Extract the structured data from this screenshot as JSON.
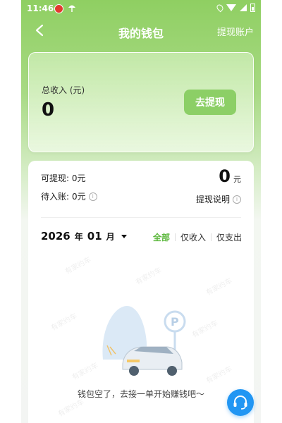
{
  "statusbar": {
    "time": "11:46"
  },
  "header": {
    "title": "我的钱包",
    "right_action": "提现账户"
  },
  "income_card": {
    "label": "总收入 (元)",
    "value": "0",
    "button": "去提现"
  },
  "balance": {
    "withdrawable_label": "可提现:",
    "withdrawable_value": "0元",
    "pending_label": "待入账:",
    "pending_value": "0元",
    "amount": "0",
    "unit": "元",
    "explain": "提现说明"
  },
  "list": {
    "year": "2026",
    "year_suffix": "年",
    "month": "01",
    "month_suffix": "月",
    "filters": [
      "全部",
      "仅收入",
      "仅支出"
    ],
    "active_filter": "全部",
    "empty_text": "钱包空了，去接一单开始赚钱吧～",
    "watermark": "有家约车"
  },
  "colors": {
    "accent": "#5cb83d",
    "button": "#8ccf66",
    "service": "#2196f3"
  },
  "icons": [
    "back-arrow-icon",
    "info-icon",
    "caret-down-icon",
    "customer-service-icon",
    "empty-wallet-illustration"
  ]
}
